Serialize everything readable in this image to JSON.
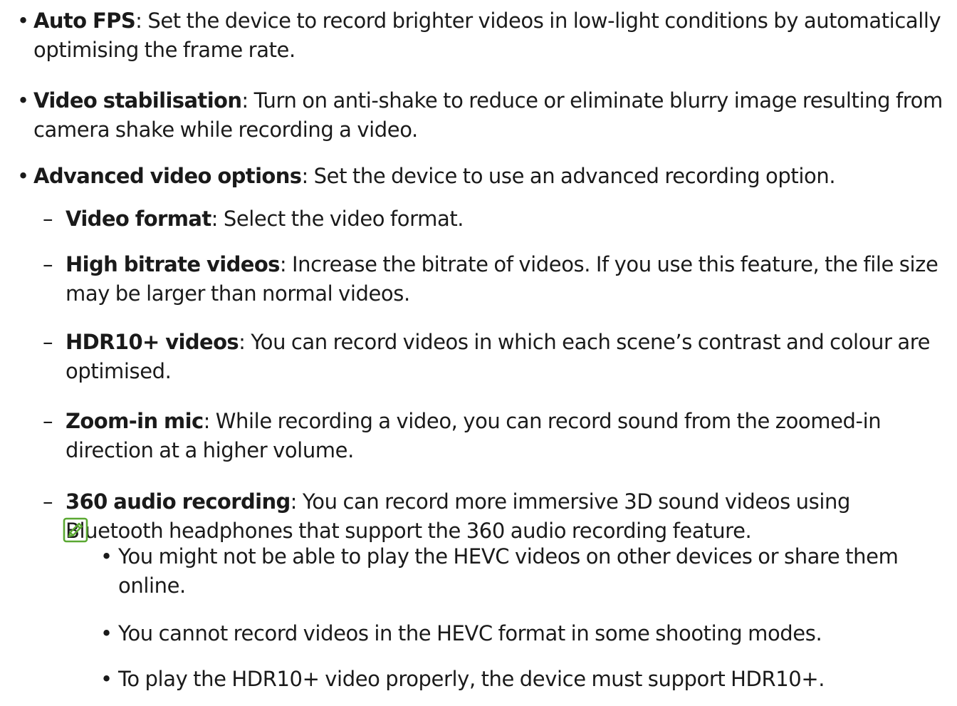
{
  "colors": {
    "text": "#1a1a1a",
    "note_icon": "#5aa832"
  },
  "bullets": [
    {
      "term": "Auto FPS",
      "description": ": Set the device to record brighter videos in low-light conditions by automatically optimising the frame rate."
    },
    {
      "term": "Video stabilisation",
      "description": ": Turn on anti-shake to reduce or eliminate blurry image resulting from camera shake while recording a video."
    },
    {
      "term": "Advanced video options",
      "description": ": Set the device to use an advanced recording option."
    }
  ],
  "sub_items": [
    {
      "term": "Video format",
      "description": ": Select the video format."
    },
    {
      "term": "High bitrate videos",
      "description": ": Increase the bitrate of videos. If you use this feature, the file size may be larger than normal videos."
    },
    {
      "term": "HDR10+ videos",
      "description": ": You can record videos in which each scene’s contrast and colour are optimised."
    },
    {
      "term": "Zoom-in mic",
      "description": ": While recording a video, you can record sound from the zoomed-in direction at a higher volume."
    },
    {
      "term": "360 audio recording",
      "description": ": You can record more immersive 3D sound videos using Bluetooth headphones that support the 360 audio recording feature."
    }
  ],
  "note": {
    "icon": "note-pencil-icon",
    "items": [
      "You might not be able to play the HEVC videos on other devices or share them online.",
      "You cannot record videos in the HEVC format in some shooting modes.",
      "To play the HDR10+ video properly, the device must support HDR10+."
    ]
  },
  "markers": {
    "bullet": "•",
    "dash": "–"
  }
}
